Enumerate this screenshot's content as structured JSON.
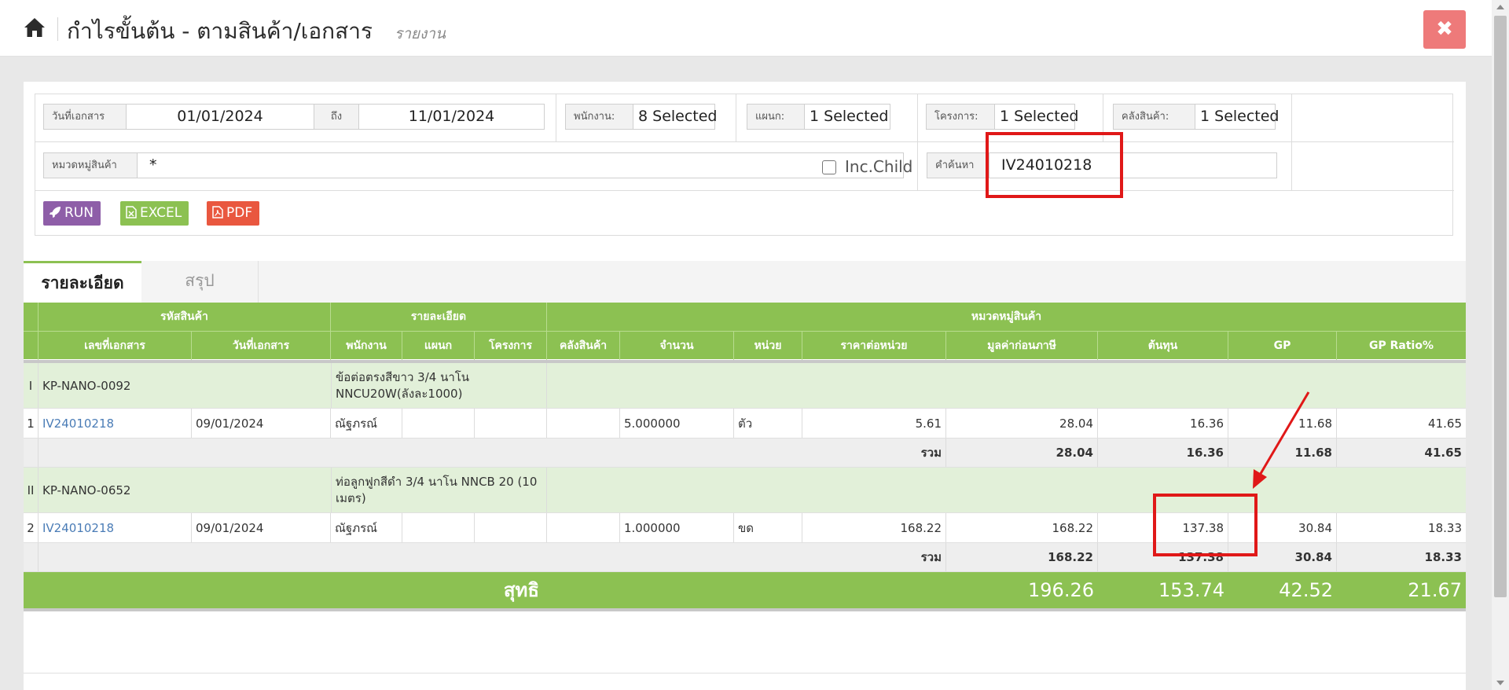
{
  "header": {
    "title": "กำไรขั้นต้น - ตามสินค้า/เอกสาร",
    "subtitle": "รายงาน",
    "close_symbol": "✖"
  },
  "filters": {
    "doc_date_label": "วันที่เอกสาร",
    "date_from": "01/01/2024",
    "to_label": "ถึง",
    "date_to": "11/01/2024",
    "employee_label": "พนักงาน:",
    "employee_value": "8 Selected",
    "department_label": "แผนก:",
    "department_value": "1 Selected",
    "project_label": "โครงการ:",
    "project_value": "1 Selected",
    "warehouse_label": "คลังสินค้า:",
    "warehouse_value": "1 Selected",
    "category_label": "หมวดหมู่สินค้า",
    "category_value": "*",
    "inc_child_label": "Inc.Child",
    "search_label": "คำค้นหา",
    "search_value": "IV24010218"
  },
  "actions": {
    "run": "RUN",
    "excel": "EXCEL",
    "pdf": "PDF"
  },
  "tabs": [
    {
      "label": "รายละเอียด",
      "active": true
    },
    {
      "label": "สรุป",
      "active": false
    }
  ],
  "table": {
    "group_headers": [
      "รหัสสินค้า",
      "รายละเอียด",
      "หมวดหมู่สินค้า"
    ],
    "columns": [
      "เลขที่เอกสาร",
      "วันที่เอกสาร",
      "พนักงาน",
      "แผนก",
      "โครงการ",
      "คลังสินค้า",
      "จำนวน",
      "หน่วย",
      "ราคาต่อหน่วย",
      "มูลค่าก่อนภาษี",
      "ต้นทุน",
      "GP",
      "GP Ratio%"
    ],
    "groups": [
      {
        "index": "I",
        "code": "KP-NANO-0092",
        "description": "ข้อต่อตรงสีขาว 3/4 นาโน NNCU20W(ลังละ1000)",
        "items": [
          {
            "no": "1",
            "doc_no": "IV24010218",
            "doc_date": "09/01/2024",
            "employee": "ณัฐภรณ์",
            "department": "",
            "project": "",
            "warehouse": "",
            "qty": "5.000000",
            "unit": "ตัว",
            "unit_price": "5.61",
            "amount": "28.04",
            "cost": "16.36",
            "gp": "11.68",
            "gp_ratio": "41.65"
          }
        ],
        "subtotal": {
          "label": "รวม",
          "amount": "28.04",
          "cost": "16.36",
          "gp": "11.68",
          "gp_ratio": "41.65"
        }
      },
      {
        "index": "II",
        "code": "KP-NANO-0652",
        "description": "ท่อลูกฟูกสีดำ 3/4 นาโน NNCB 20 (10 เมตร)",
        "items": [
          {
            "no": "2",
            "doc_no": "IV24010218",
            "doc_date": "09/01/2024",
            "employee": "ณัฐภรณ์",
            "department": "",
            "project": "",
            "warehouse": "",
            "qty": "1.000000",
            "unit": "ขด",
            "unit_price": "168.22",
            "amount": "168.22",
            "cost": "137.38",
            "gp": "30.84",
            "gp_ratio": "18.33"
          }
        ],
        "subtotal": {
          "label": "รวม",
          "amount": "168.22",
          "cost": "137.38",
          "gp": "30.84",
          "gp_ratio": "18.33"
        }
      }
    ],
    "net": {
      "label": "สุทธิ",
      "amount": "196.26",
      "cost": "153.74",
      "gp": "42.52",
      "gp_ratio": "21.67"
    }
  },
  "colors": {
    "accent_green": "#8cc152",
    "group_row": "#e2f0d9",
    "annotation_red": "#e01818",
    "link_blue": "#4a7cb6",
    "close_button": "#ee7a7a"
  }
}
